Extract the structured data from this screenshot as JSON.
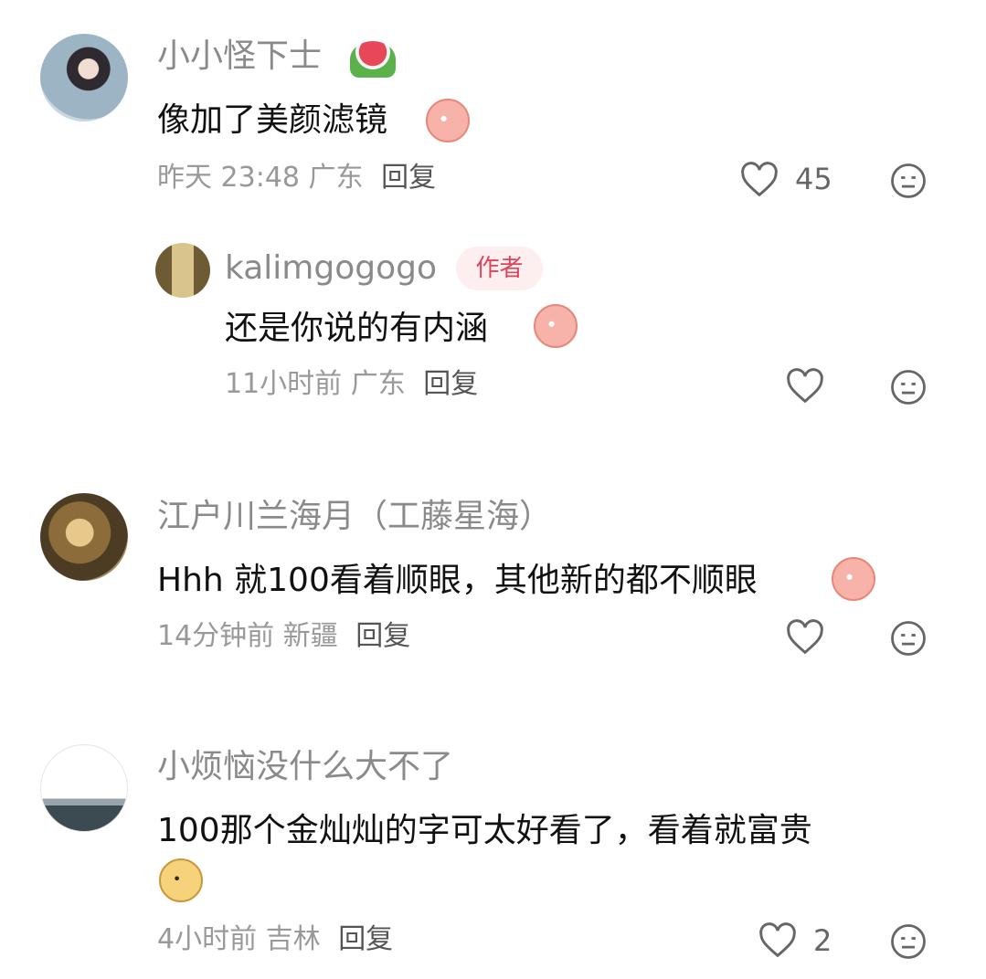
{
  "comments": [
    {
      "username": "小小怪下士",
      "emoji": "watermelon",
      "text": "像加了美颜滤镜",
      "text_emoji": "peach-crying",
      "time": "昨天 23:48",
      "location": "广东",
      "reply_label": "回复",
      "likes": "45"
    },
    {
      "username": "kalimgogogo",
      "badge": "作者",
      "text": "还是你说的有内涵",
      "text_emoji": "peach-shy",
      "time": "11小时前",
      "location": "广东",
      "reply_label": "回复"
    },
    {
      "username": "江户川兰海月（工藤星海）",
      "text": "Hhh 就100看着顺眼，其他新的都不顺眼",
      "text_emoji": "peach-shy",
      "time": "14分钟前",
      "location": "新疆",
      "reply_label": "回复"
    },
    {
      "username": "小烦恼没什么大不了",
      "text": "100那个金灿灿的字可太好看了，看着就富贵",
      "text_emoji": "yellow-smile",
      "time": "4小时前",
      "location": "吉林",
      "reply_label": "回复",
      "likes": "2"
    }
  ],
  "icons": {
    "like": "heart-outline-icon",
    "dislike": "meh-face-icon"
  }
}
